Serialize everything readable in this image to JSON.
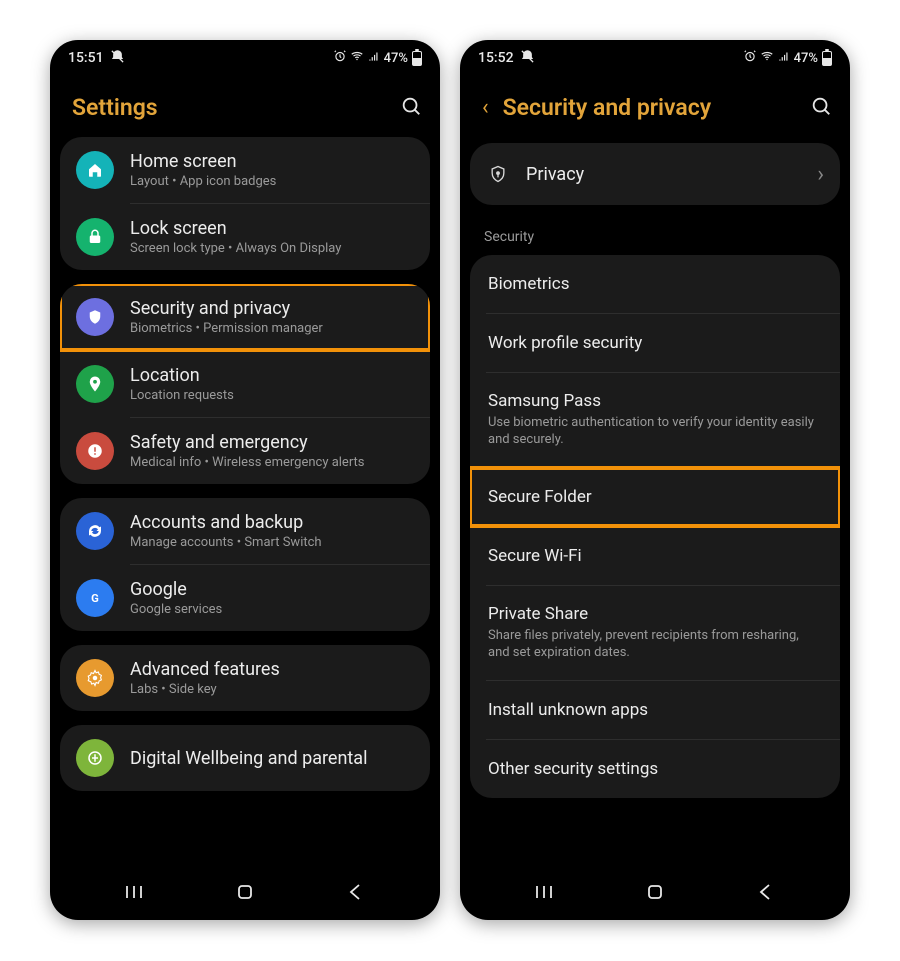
{
  "left": {
    "status": {
      "time": "15:51",
      "battery": "47%"
    },
    "header": {
      "title": "Settings"
    },
    "groups": [
      {
        "items": [
          {
            "icon": "home",
            "color": "c-teal",
            "title": "Home screen",
            "subtitle": "Layout  •  App icon badges"
          },
          {
            "icon": "lock",
            "color": "c-green",
            "title": "Lock screen",
            "subtitle": "Screen lock type  •  Always On Display"
          }
        ]
      },
      {
        "highlight_index": 0,
        "items": [
          {
            "icon": "shield",
            "color": "c-purple",
            "title": "Security and privacy",
            "subtitle": "Biometrics  •  Permission manager"
          },
          {
            "icon": "pin",
            "color": "c-green2",
            "title": "Location",
            "subtitle": "Location requests"
          },
          {
            "icon": "alert",
            "color": "c-red",
            "title": "Safety and emergency",
            "subtitle": "Medical info  •  Wireless emergency alerts"
          }
        ]
      },
      {
        "items": [
          {
            "icon": "sync",
            "color": "c-blue",
            "title": "Accounts and backup",
            "subtitle": "Manage accounts  •  Smart Switch"
          },
          {
            "icon": "google",
            "color": "c-gblue",
            "title": "Google",
            "subtitle": "Google services"
          }
        ]
      },
      {
        "items": [
          {
            "icon": "gear",
            "color": "c-orange",
            "title": "Advanced features",
            "subtitle": "Labs  •  Side key"
          }
        ]
      },
      {
        "items": [
          {
            "icon": "plant",
            "color": "c-lime",
            "title": "Digital Wellbeing and parental",
            "subtitle": ""
          }
        ]
      }
    ]
  },
  "right": {
    "status": {
      "time": "15:52",
      "battery": "47%"
    },
    "header": {
      "title": "Security and privacy"
    },
    "privacy_label": "Privacy",
    "section_label": "Security",
    "highlight_index": 3,
    "items": [
      {
        "title": "Biometrics"
      },
      {
        "title": "Work profile security"
      },
      {
        "title": "Samsung Pass",
        "subtitle": "Use biometric authentication to verify your identity easily and securely."
      },
      {
        "title": "Secure Folder"
      },
      {
        "title": "Secure Wi-Fi"
      },
      {
        "title": "Private Share",
        "subtitle": "Share files privately, prevent recipients from resharing, and set expiration dates."
      },
      {
        "title": "Install unknown apps"
      },
      {
        "title": "Other security settings"
      }
    ]
  }
}
